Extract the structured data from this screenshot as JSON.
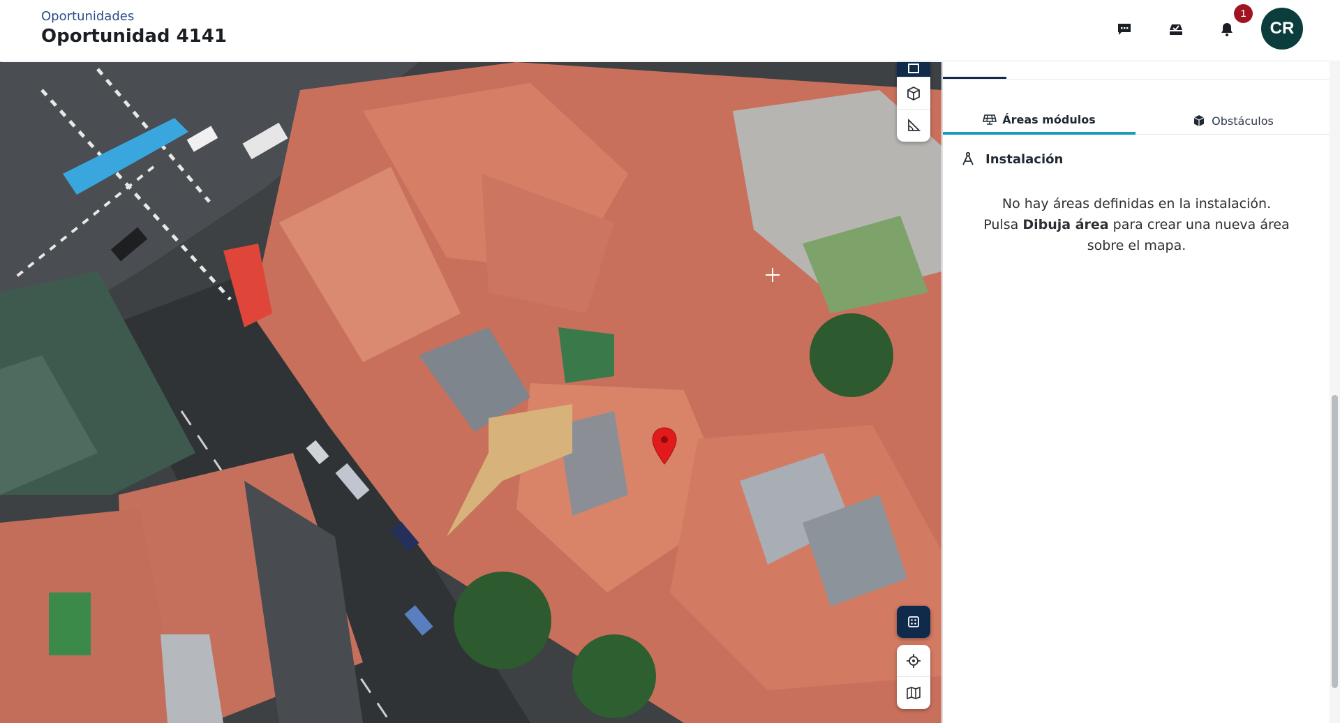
{
  "header": {
    "breadcrumb": "Oportunidades",
    "title": "Oportunidad 4141",
    "notification_count": "1",
    "avatar_initials": "CR",
    "icons": [
      "chat-icon",
      "tasks-icon",
      "bell-icon"
    ]
  },
  "map": {
    "tools_top": [
      "draw-area-icon",
      "obstacle-cube-icon",
      "measure-angle-icon"
    ],
    "tools_bottom": [
      "grid-layout-icon",
      "locate-icon",
      "map-layers-icon"
    ],
    "marker": "location-pin-icon"
  },
  "panel": {
    "tabs": [
      {
        "label": "Áreas módulos",
        "icon": "solar-panel-icon",
        "active": true
      },
      {
        "label": "Obstáculos",
        "icon": "cube-icon",
        "active": false
      }
    ],
    "section_title": "Instalación",
    "empty_line1": "No hay áreas definidas en la instalación.",
    "empty_line2_prefix": "Pulsa ",
    "empty_line2_bold": "Dibuja área",
    "empty_line2_suffix": " para crear una nueva área",
    "empty_line3": "sobre el mapa."
  },
  "colors": {
    "accent": "#1a9bb8",
    "navy": "#0f2a4a",
    "badge": "#a01421",
    "avatar": "#0b3d3d",
    "link": "#2b4c8c"
  }
}
